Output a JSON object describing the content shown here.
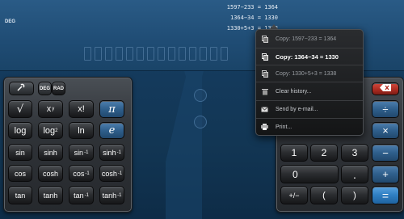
{
  "display": {
    "angle_mode": "DEG",
    "history": [
      "1597−233 = 1364",
      "1364−34 = 1330",
      "1330+5+3 = 1338"
    ]
  },
  "toolbar": {
    "settings_icon": "wrench-icon",
    "deg_label": "DEG",
    "rad_label": "RAD"
  },
  "left_keys": {
    "sqrt": "√",
    "x_pow_y_base": "x",
    "x_pow_y_exp": "y",
    "factorial": "x!",
    "pi": "π",
    "log": "log",
    "log2_base": "log",
    "log2_sub": "2",
    "ln": "ln",
    "e": "e",
    "sin": "sin",
    "sinh": "sinh",
    "asin": "sin",
    "asinh": "sinh",
    "cos": "cos",
    "cosh": "cosh",
    "acos": "cos",
    "acosh": "cosh",
    "tan": "tan",
    "tanh": "tanh",
    "atan": "tan",
    "atanh": "tanh",
    "inv_exp": "-1"
  },
  "right_keys": {
    "divide": "÷",
    "multiply": "×",
    "minus": "−",
    "plus": "+",
    "one": "1",
    "two": "2",
    "three": "3",
    "zero": "0",
    "dot": ".",
    "plus_minus": "+/−",
    "open_paren": "(",
    "close_paren": ")",
    "equals": "="
  },
  "menu": {
    "items": [
      {
        "label": "Copy: 1597−233 = 1364",
        "icon": "copy-icon"
      },
      {
        "label": "Copy: 1364−34 = 1330",
        "icon": "copy-icon"
      },
      {
        "label": "Copy: 1330+5+3 = 1338",
        "icon": "copy-icon"
      },
      {
        "label": "Clear history...",
        "icon": "trash-icon"
      },
      {
        "label": "Send by e-mail...",
        "icon": "mail-icon"
      },
      {
        "label": "Print...",
        "icon": "printer-icon"
      }
    ]
  }
}
